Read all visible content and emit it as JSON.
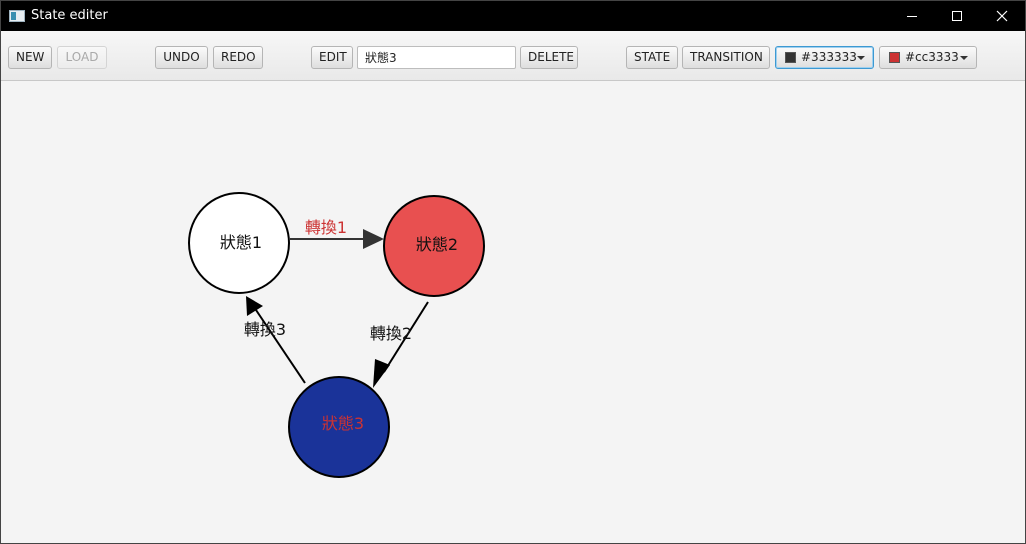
{
  "window": {
    "title": "State editer",
    "controls": {
      "minimize_icon": "minimize-icon",
      "maximize_icon": "maximize-icon",
      "close_icon": "close-icon"
    }
  },
  "toolbar": {
    "new_label": "NEW",
    "load_label": "LOAD",
    "undo_label": "UNDO",
    "redo_label": "REDO",
    "edit_label": "EDIT",
    "name_value": "狀態3",
    "delete_label": "DELETE",
    "state_label": "STATE",
    "transition_label": "TRANSITION",
    "stroke_color": "#333333",
    "text_color": "#cc3333"
  },
  "graph": {
    "states": [
      {
        "label": "狀態1",
        "fill": "#ffffff",
        "text_color": "#111111"
      },
      {
        "label": "狀態2",
        "fill": "#e85050",
        "text_color": "#111111"
      },
      {
        "label": "狀態3",
        "fill": "#1a3399",
        "text_color": "#cc3333"
      }
    ],
    "transitions": [
      {
        "label": "轉換1",
        "from": "狀態1",
        "to": "狀態2",
        "color": "#333333",
        "label_color": "#cc3333"
      },
      {
        "label": "轉換2",
        "from": "狀態2",
        "to": "狀態3",
        "color": "#000000",
        "label_color": "#111111"
      },
      {
        "label": "轉換3",
        "from": "狀態3",
        "to": "狀態1",
        "color": "#000000",
        "label_color": "#111111"
      }
    ]
  }
}
